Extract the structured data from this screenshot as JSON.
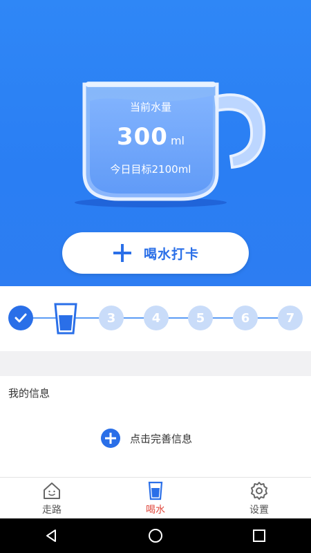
{
  "hero": {
    "current_label": "当前水量",
    "current_value": "300",
    "current_unit": "ml",
    "target_label": "今日目标2100ml"
  },
  "checkin": {
    "button_label": "喝水打卡"
  },
  "progress": {
    "steps": [
      {
        "label": "",
        "state": "done"
      },
      {
        "label": "",
        "state": "current"
      },
      {
        "label": "3",
        "state": "pending"
      },
      {
        "label": "4",
        "state": "pending"
      },
      {
        "label": "5",
        "state": "pending"
      },
      {
        "label": "6",
        "state": "pending"
      },
      {
        "label": "7",
        "state": "pending"
      }
    ]
  },
  "info": {
    "title": "我的信息",
    "complete_label": "点击完善信息"
  },
  "tabs": [
    {
      "label": "走路",
      "icon": "house-face-icon",
      "active": false
    },
    {
      "label": "喝水",
      "icon": "water-cup-icon",
      "active": true
    },
    {
      "label": "设置",
      "icon": "gear-icon",
      "active": false
    }
  ],
  "colors": {
    "primary": "#2a7ef3",
    "accent_blue": "#2a6fe8",
    "active_tab": "#e04a3f",
    "pending_step": "#c9dcf9"
  }
}
